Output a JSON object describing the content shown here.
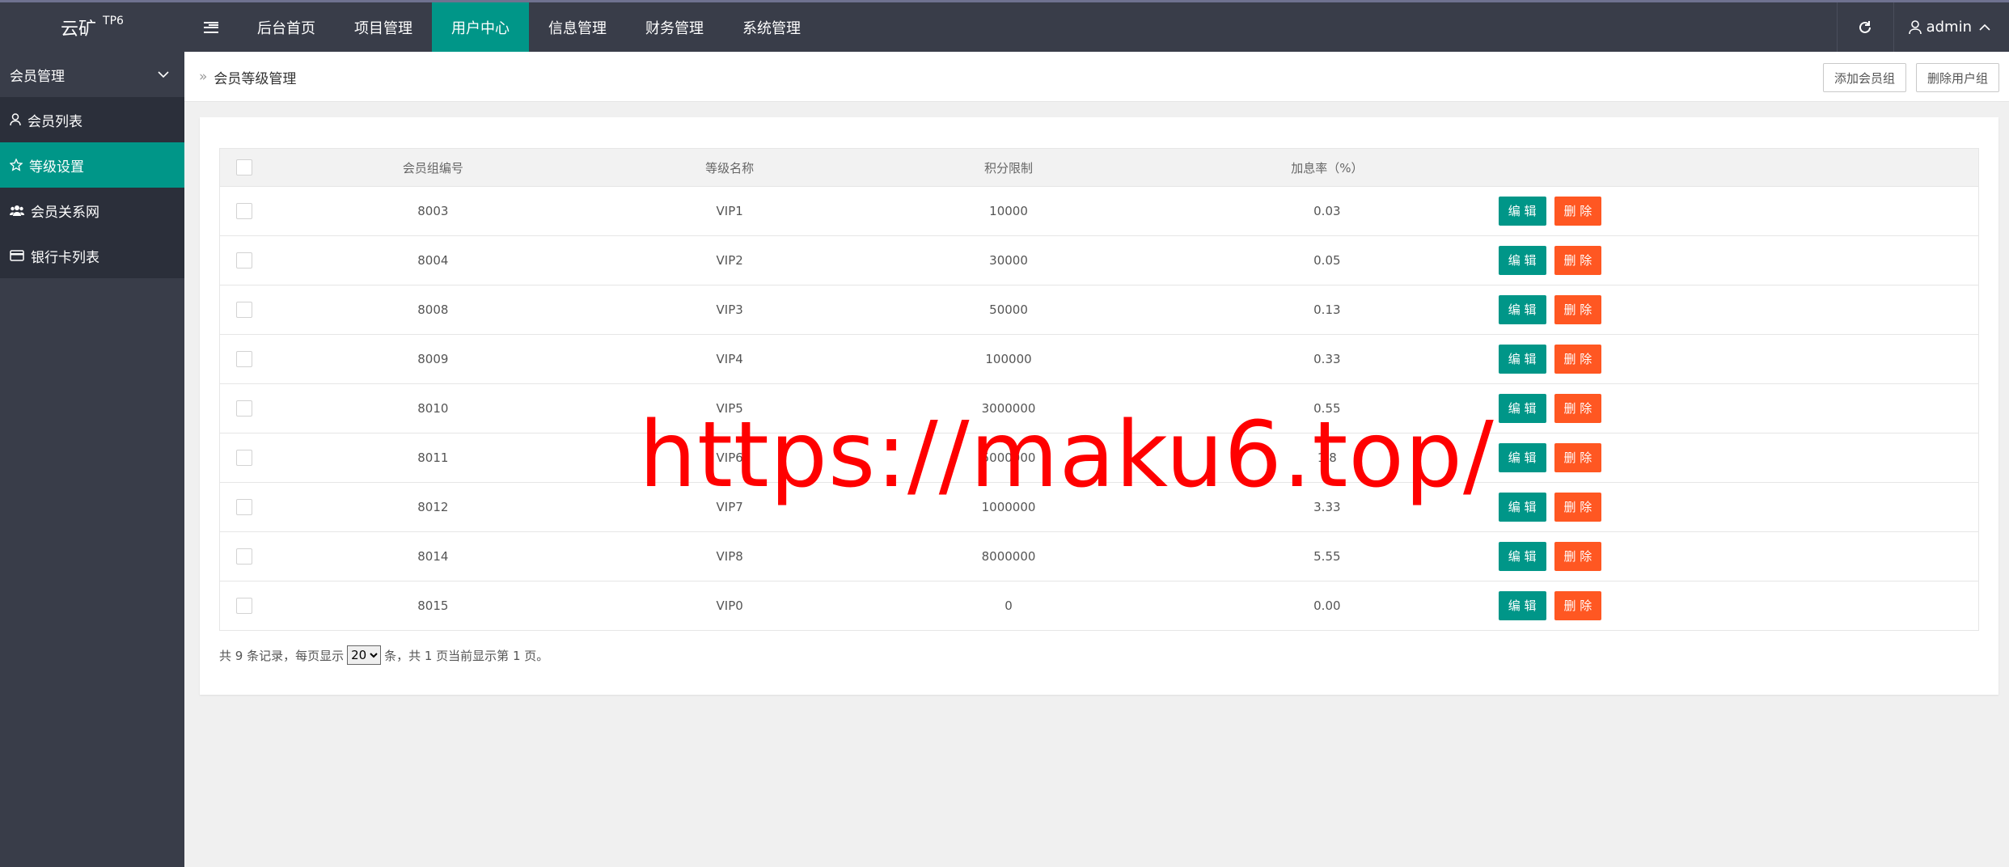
{
  "header": {
    "logo": "云矿",
    "logo_sup": "TP6",
    "nav": [
      "后台首页",
      "项目管理",
      "用户中心",
      "信息管理",
      "财务管理",
      "系统管理"
    ],
    "active_nav": "用户中心",
    "user": "admin"
  },
  "sidebar": {
    "group": "会员管理",
    "items": [
      "会员列表",
      "等级设置",
      "会员关系网",
      "银行卡列表"
    ],
    "active": "等级设置"
  },
  "breadcrumb": {
    "current": "会员等级管理",
    "add_button": "添加会员组",
    "delete_button": "删除用户组"
  },
  "table": {
    "columns": [
      "会员组编号",
      "等级名称",
      "积分限制",
      "加息率（%）"
    ],
    "rows": [
      [
        "8003",
        "VIP1",
        "10000",
        "0.03"
      ],
      [
        "8004",
        "VIP2",
        "30000",
        "0.05"
      ],
      [
        "8008",
        "VIP3",
        "50000",
        "0.13"
      ],
      [
        "8009",
        "VIP4",
        "100000",
        "0.33"
      ],
      [
        "8010",
        "VIP5",
        "3000000",
        "0.55"
      ],
      [
        "8011",
        "VIP6",
        "5000000",
        "1.8"
      ],
      [
        "8012",
        "VIP7",
        "1000000",
        "3.33"
      ],
      [
        "8014",
        "VIP8",
        "8000000",
        "5.55"
      ],
      [
        "8015",
        "VIP0",
        "0",
        "0.00"
      ]
    ],
    "edit_label": "编 辑",
    "delete_label": "删 除"
  },
  "pager": {
    "prefix": "共 9 条记录，每页显示",
    "page_size": "20",
    "suffix": "条，共 1 页当前显示第 1 页。"
  },
  "watermark": "https://maku6.top/",
  "colors": {
    "accent": "#009688",
    "danger": "#ff5722",
    "dark": "#393d49"
  }
}
